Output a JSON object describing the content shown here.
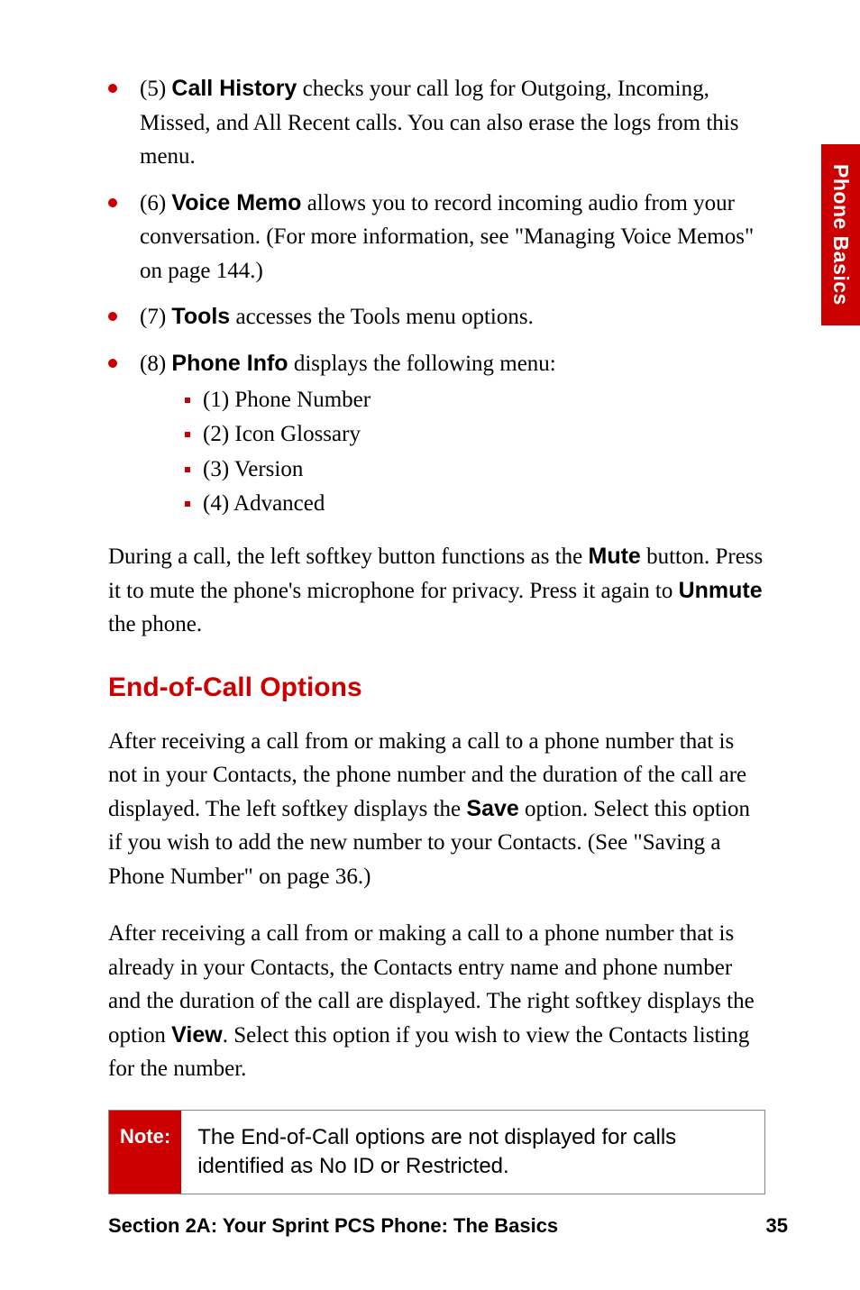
{
  "sideTab": "Phone Basics",
  "bullets": [
    {
      "prefix": "(5) ",
      "bold": "Call History",
      "rest": " checks your call log for Outgoing, Incoming, Missed, and All Recent calls. You can also erase the logs from this menu."
    },
    {
      "prefix": "(6) ",
      "bold": "Voice Memo",
      "rest": " allows you to record incoming audio from your conversation. (For more information, see \"Managing Voice Memos\" on page 144.)"
    },
    {
      "prefix": "(7) ",
      "bold": "Tools",
      "rest": " accesses the Tools menu options."
    },
    {
      "prefix": "(8) ",
      "bold": "Phone Info",
      "rest": " displays the following menu:"
    }
  ],
  "subitems": [
    "(1) Phone Number",
    "(2) Icon Glossary",
    "(3) Version",
    "(4) Advanced"
  ],
  "para1": {
    "t1": "During a call, the left softkey button functions as the ",
    "b1": "Mute",
    "t2": " button. Press it to mute the phone's microphone for privacy. Press it again to ",
    "b2": "Unmute",
    "t3": " the phone."
  },
  "heading": "End-of-Call Options",
  "para2": {
    "t1": "After receiving a call from or making a call to a phone number that is not in your Contacts, the phone number and the duration of the call are displayed. The left softkey displays the ",
    "b1": "Save",
    "t2": " option. Select this option if you wish to add the new number to your Contacts. (See \"Saving a Phone Number\" on page 36.)"
  },
  "para3": {
    "t1": "After receiving a call from or making a call to a phone number that is already in your Contacts, the Contacts entry name and phone number and the duration of the call are displayed. The right softkey displays the option ",
    "b1": "View",
    "t2": ". Select this option if you wish to view the Contacts listing for the number."
  },
  "note": {
    "label": "Note:",
    "text": "The End-of-Call options are not displayed for calls identified as No ID or Restricted."
  },
  "footer": {
    "left": "Section 2A: Your Sprint PCS Phone: The Basics",
    "right": "35"
  }
}
